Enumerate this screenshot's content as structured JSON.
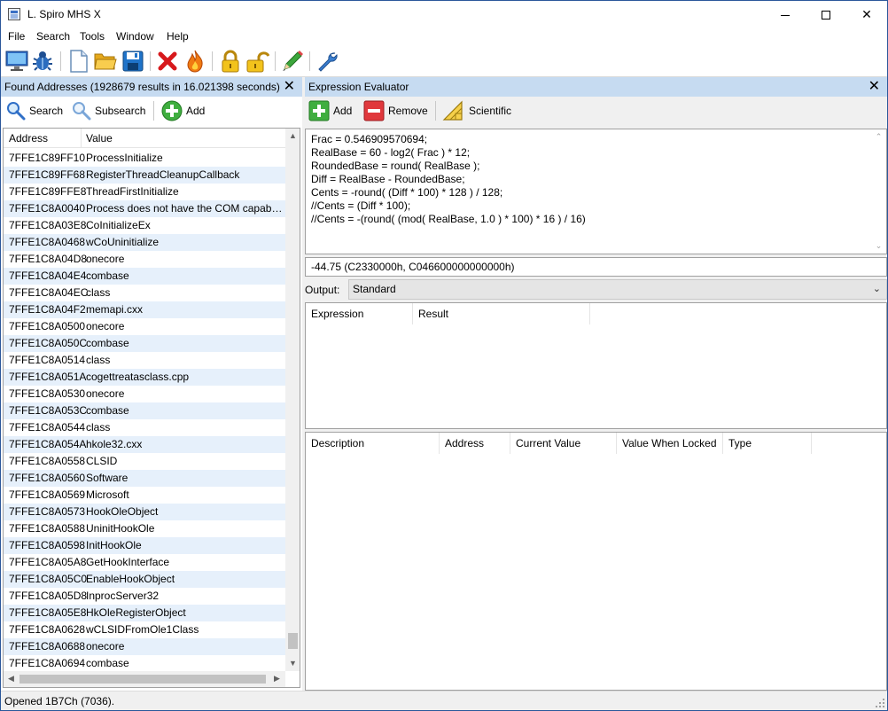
{
  "window": {
    "title": "L. Spiro MHS X",
    "min_glyph": "—",
    "close_glyph": "✕"
  },
  "menu": [
    "File",
    "Search",
    "Tools",
    "Window",
    "Help"
  ],
  "toolbar": {
    "icons": [
      "computer-icon",
      "bug-icon",
      "new-file-icon",
      "open-folder-icon",
      "save-icon",
      "delete-icon",
      "fire-icon",
      "lock-icon",
      "unlock-icon",
      "pencil-icon",
      "wrench-icon"
    ]
  },
  "found_addresses": {
    "title": "Found Addresses (1928679 results in 16.021398 seconds)",
    "close_glyph": "✕",
    "buttons": {
      "search": "Search",
      "subsearch": "Subsearch",
      "add": "Add"
    },
    "columns": {
      "address": "Address",
      "value": "Value"
    },
    "rows": [
      {
        "address": "7FFE1C89FF10",
        "value": "ProcessInitialize"
      },
      {
        "address": "7FFE1C89FF68",
        "value": "RegisterThreadCleanupCallback"
      },
      {
        "address": "7FFE1C89FFE8",
        "value": "ThreadFirstInitialize"
      },
      {
        "address": "7FFE1C8A0040",
        "value": "Process does not have the COM capabili..."
      },
      {
        "address": "7FFE1C8A03E8",
        "value": "CoInitializeEx"
      },
      {
        "address": "7FFE1C8A0468",
        "value": "wCoUninitialize"
      },
      {
        "address": "7FFE1C8A04D8",
        "value": "onecore"
      },
      {
        "address": "7FFE1C8A04E4",
        "value": "combase"
      },
      {
        "address": "7FFE1C8A04EC",
        "value": "class"
      },
      {
        "address": "7FFE1C8A04F2",
        "value": "memapi.cxx"
      },
      {
        "address": "7FFE1C8A0500",
        "value": "onecore"
      },
      {
        "address": "7FFE1C8A050C",
        "value": "combase"
      },
      {
        "address": "7FFE1C8A0514",
        "value": "class"
      },
      {
        "address": "7FFE1C8A051A",
        "value": "cogettreatasclass.cpp"
      },
      {
        "address": "7FFE1C8A0530",
        "value": "onecore"
      },
      {
        "address": "7FFE1C8A053C",
        "value": "combase"
      },
      {
        "address": "7FFE1C8A0544",
        "value": "class"
      },
      {
        "address": "7FFE1C8A054A",
        "value": "hkole32.cxx"
      },
      {
        "address": "7FFE1C8A0558",
        "value": "CLSID"
      },
      {
        "address": "7FFE1C8A0560",
        "value": "Software"
      },
      {
        "address": "7FFE1C8A0569",
        "value": "Microsoft"
      },
      {
        "address": "7FFE1C8A0573",
        "value": "HookOleObject"
      },
      {
        "address": "7FFE1C8A0588",
        "value": "UninitHookOle"
      },
      {
        "address": "7FFE1C8A0598",
        "value": "InitHookOle"
      },
      {
        "address": "7FFE1C8A05A8",
        "value": "GetHookInterface"
      },
      {
        "address": "7FFE1C8A05C0",
        "value": "EnableHookObject"
      },
      {
        "address": "7FFE1C8A05D8",
        "value": "InprocServer32"
      },
      {
        "address": "7FFE1C8A05E8",
        "value": "HkOleRegisterObject"
      },
      {
        "address": "7FFE1C8A0628",
        "value": "wCLSIDFromOle1Class"
      },
      {
        "address": "7FFE1C8A0688",
        "value": "onecore"
      },
      {
        "address": "7FFE1C8A0694",
        "value": "combase"
      }
    ]
  },
  "expression_evaluator": {
    "title": "Expression Evaluator",
    "close_glyph": "✕",
    "buttons": {
      "add": "Add",
      "remove": "Remove",
      "scientific": "Scientific"
    },
    "expression": "Frac = 0.546909570694;\nRealBase = 60 - log2( Frac ) * 12;\nRoundedBase = round( RealBase );\nDiff = RealBase - RoundedBase;\nCents = -round( (Diff * 100) * 128 ) / 128;\n//Cents = (Diff * 100);\n//Cents = -(round( (mod( RealBase, 1.0 ) * 100) * 16 ) / 16)",
    "result": "-44.75 (C2330000h, C046600000000000h)",
    "output_label": "Output:",
    "output_value": "Standard",
    "results_columns": [
      "Expression",
      "Result"
    ],
    "locked_columns": [
      "Description",
      "Address",
      "Current Value",
      "Value When Locked",
      "Type"
    ]
  },
  "status": "Opened 1B7Ch (7036)."
}
